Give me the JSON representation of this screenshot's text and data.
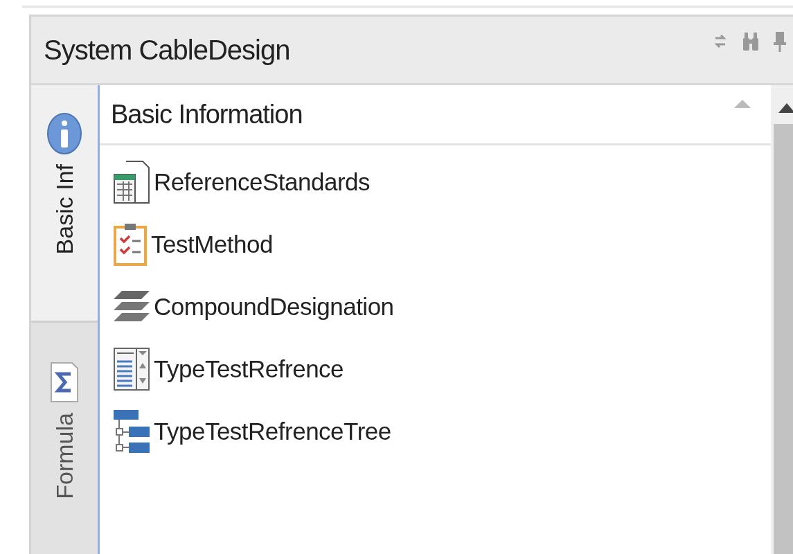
{
  "panel": {
    "title": "System CableDesign"
  },
  "side_tabs": [
    {
      "label": "Basic Inf",
      "kind": "info",
      "selected": true
    },
    {
      "label": "Formula",
      "kind": "formula",
      "selected": false
    }
  ],
  "section": {
    "title": "Basic Information",
    "expanded": true
  },
  "items": [
    {
      "label": "ReferenceStandards",
      "kind": "sheet"
    },
    {
      "label": "TestMethod",
      "kind": "checklist"
    },
    {
      "label": "CompoundDesignation",
      "kind": "layers"
    },
    {
      "label": "TypeTestRefrence",
      "kind": "listbox"
    },
    {
      "label": "TypeTestRefrenceTree",
      "kind": "tree"
    }
  ]
}
